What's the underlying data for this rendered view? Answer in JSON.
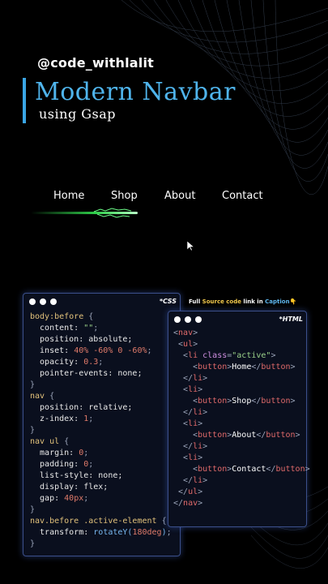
{
  "handle": "@code_withlalit",
  "title": "Modern Navbar",
  "subtitle": "using Gsap",
  "nav": [
    "Home",
    "Shop",
    "About",
    "Contact"
  ],
  "caption": {
    "pre": "Full ",
    "mid": "Source code",
    "mid2": " link in ",
    "end": "Caption",
    "emoji": "👇"
  },
  "css_box": {
    "tag": "*CSS",
    "lines": [
      [
        [
          "c-sel",
          "body:before"
        ],
        [
          "c-pun",
          " {"
        ]
      ],
      [
        [
          "c-prop",
          "  content: "
        ],
        [
          "c-str",
          "\"\""
        ],
        [
          "c-pun",
          ";"
        ]
      ],
      [
        [
          "c-prop",
          "  position: absolute;"
        ]
      ],
      [
        [
          "c-prop",
          "  inset: "
        ],
        [
          "c-num",
          "40% -60% 0 -60%"
        ],
        [
          "c-pun",
          ";"
        ]
      ],
      [
        [
          "c-prop",
          "  opacity: "
        ],
        [
          "c-num",
          "0.3"
        ],
        [
          "c-pun",
          ";"
        ]
      ],
      [
        [
          "c-prop",
          "  pointer-events: none;"
        ]
      ],
      [
        [
          "c-pun",
          "}"
        ]
      ],
      [
        [
          "c-sel",
          "nav"
        ],
        [
          "c-pun",
          " {"
        ]
      ],
      [
        [
          "c-prop",
          "  position: relative;"
        ]
      ],
      [
        [
          "c-prop",
          "  z-index: "
        ],
        [
          "c-num",
          "1"
        ],
        [
          "c-pun",
          ";"
        ]
      ],
      [
        [
          "c-pun",
          "}"
        ]
      ],
      [
        [
          "c-sel",
          "nav ul"
        ],
        [
          "c-pun",
          " {"
        ]
      ],
      [
        [
          "c-prop",
          "  margin: "
        ],
        [
          "c-num",
          "0"
        ],
        [
          "c-pun",
          ";"
        ]
      ],
      [
        [
          "c-prop",
          "  padding: "
        ],
        [
          "c-num",
          "0"
        ],
        [
          "c-pun",
          ";"
        ]
      ],
      [
        [
          "c-prop",
          "  list-style: none;"
        ]
      ],
      [
        [
          "c-prop",
          "  display: flex;"
        ]
      ],
      [
        [
          "c-prop",
          "  gap: "
        ],
        [
          "c-num",
          "40px"
        ],
        [
          "c-pun",
          ";"
        ]
      ],
      [
        [
          "c-pun",
          "}"
        ]
      ],
      [
        [
          "c-sel",
          "nav.before .active-element"
        ],
        [
          "c-pun",
          " {"
        ]
      ],
      [
        [
          "c-prop",
          "  transform: "
        ],
        [
          "c-fn",
          "rotateY("
        ],
        [
          "c-num",
          "180deg"
        ],
        [
          "c-fn",
          ")"
        ],
        [
          "c-pun",
          ";"
        ]
      ],
      [
        [
          "c-pun",
          "}"
        ]
      ]
    ]
  },
  "html_box": {
    "tag": "*HTML",
    "lines": [
      [
        [
          "c-pun",
          "<"
        ],
        [
          "c-tag",
          "nav"
        ],
        [
          "c-pun",
          ">"
        ]
      ],
      [
        [
          "c-pun",
          " <"
        ],
        [
          "c-tag",
          "ul"
        ],
        [
          "c-pun",
          ">"
        ]
      ],
      [
        [
          "c-pun",
          "  <"
        ],
        [
          "c-tag",
          "li"
        ],
        [
          "c-attr",
          " class"
        ],
        [
          "c-pun",
          "="
        ],
        [
          "c-str",
          "\"active\""
        ],
        [
          "c-pun",
          ">"
        ]
      ],
      [
        [
          "c-pun",
          "    <"
        ],
        [
          "c-tag",
          "button"
        ],
        [
          "c-pun",
          ">"
        ],
        [
          "c-txt",
          "Home"
        ],
        [
          "c-pun",
          "</"
        ],
        [
          "c-tag",
          "button"
        ],
        [
          "c-pun",
          ">"
        ]
      ],
      [
        [
          "c-pun",
          "  </"
        ],
        [
          "c-tag",
          "li"
        ],
        [
          "c-pun",
          ">"
        ]
      ],
      [
        [
          "c-pun",
          "  <"
        ],
        [
          "c-tag",
          "li"
        ],
        [
          "c-pun",
          ">"
        ]
      ],
      [
        [
          "c-pun",
          "    <"
        ],
        [
          "c-tag",
          "button"
        ],
        [
          "c-pun",
          ">"
        ],
        [
          "c-txt",
          "Shop"
        ],
        [
          "c-pun",
          "</"
        ],
        [
          "c-tag",
          "button"
        ],
        [
          "c-pun",
          ">"
        ]
      ],
      [
        [
          "c-pun",
          "  </"
        ],
        [
          "c-tag",
          "li"
        ],
        [
          "c-pun",
          ">"
        ]
      ],
      [
        [
          "c-pun",
          "  <"
        ],
        [
          "c-tag",
          "li"
        ],
        [
          "c-pun",
          ">"
        ]
      ],
      [
        [
          "c-pun",
          "    <"
        ],
        [
          "c-tag",
          "button"
        ],
        [
          "c-pun",
          ">"
        ],
        [
          "c-txt",
          "About"
        ],
        [
          "c-pun",
          "</"
        ],
        [
          "c-tag",
          "button"
        ],
        [
          "c-pun",
          ">"
        ]
      ],
      [
        [
          "c-pun",
          "  </"
        ],
        [
          "c-tag",
          "li"
        ],
        [
          "c-pun",
          ">"
        ]
      ],
      [
        [
          "c-pun",
          "  <"
        ],
        [
          "c-tag",
          "li"
        ],
        [
          "c-pun",
          ">"
        ]
      ],
      [
        [
          "c-pun",
          "    <"
        ],
        [
          "c-tag",
          "button"
        ],
        [
          "c-pun",
          ">"
        ],
        [
          "c-txt",
          "Contact"
        ],
        [
          "c-pun",
          "</"
        ],
        [
          "c-tag",
          "button"
        ],
        [
          "c-pun",
          ">"
        ]
      ],
      [
        [
          "c-pun",
          "  </"
        ],
        [
          "c-tag",
          "li"
        ],
        [
          "c-pun",
          ">"
        ]
      ],
      [
        [
          "c-pun",
          " </"
        ],
        [
          "c-tag",
          "ul"
        ],
        [
          "c-pun",
          ">"
        ]
      ],
      [
        [
          "c-pun",
          "</"
        ],
        [
          "c-tag",
          "nav"
        ],
        [
          "c-pun",
          ">"
        ]
      ]
    ]
  },
  "colors": {
    "accent": "#4fb4ec",
    "glow": "#39ff5a",
    "box_border": "#3b4f8a"
  }
}
